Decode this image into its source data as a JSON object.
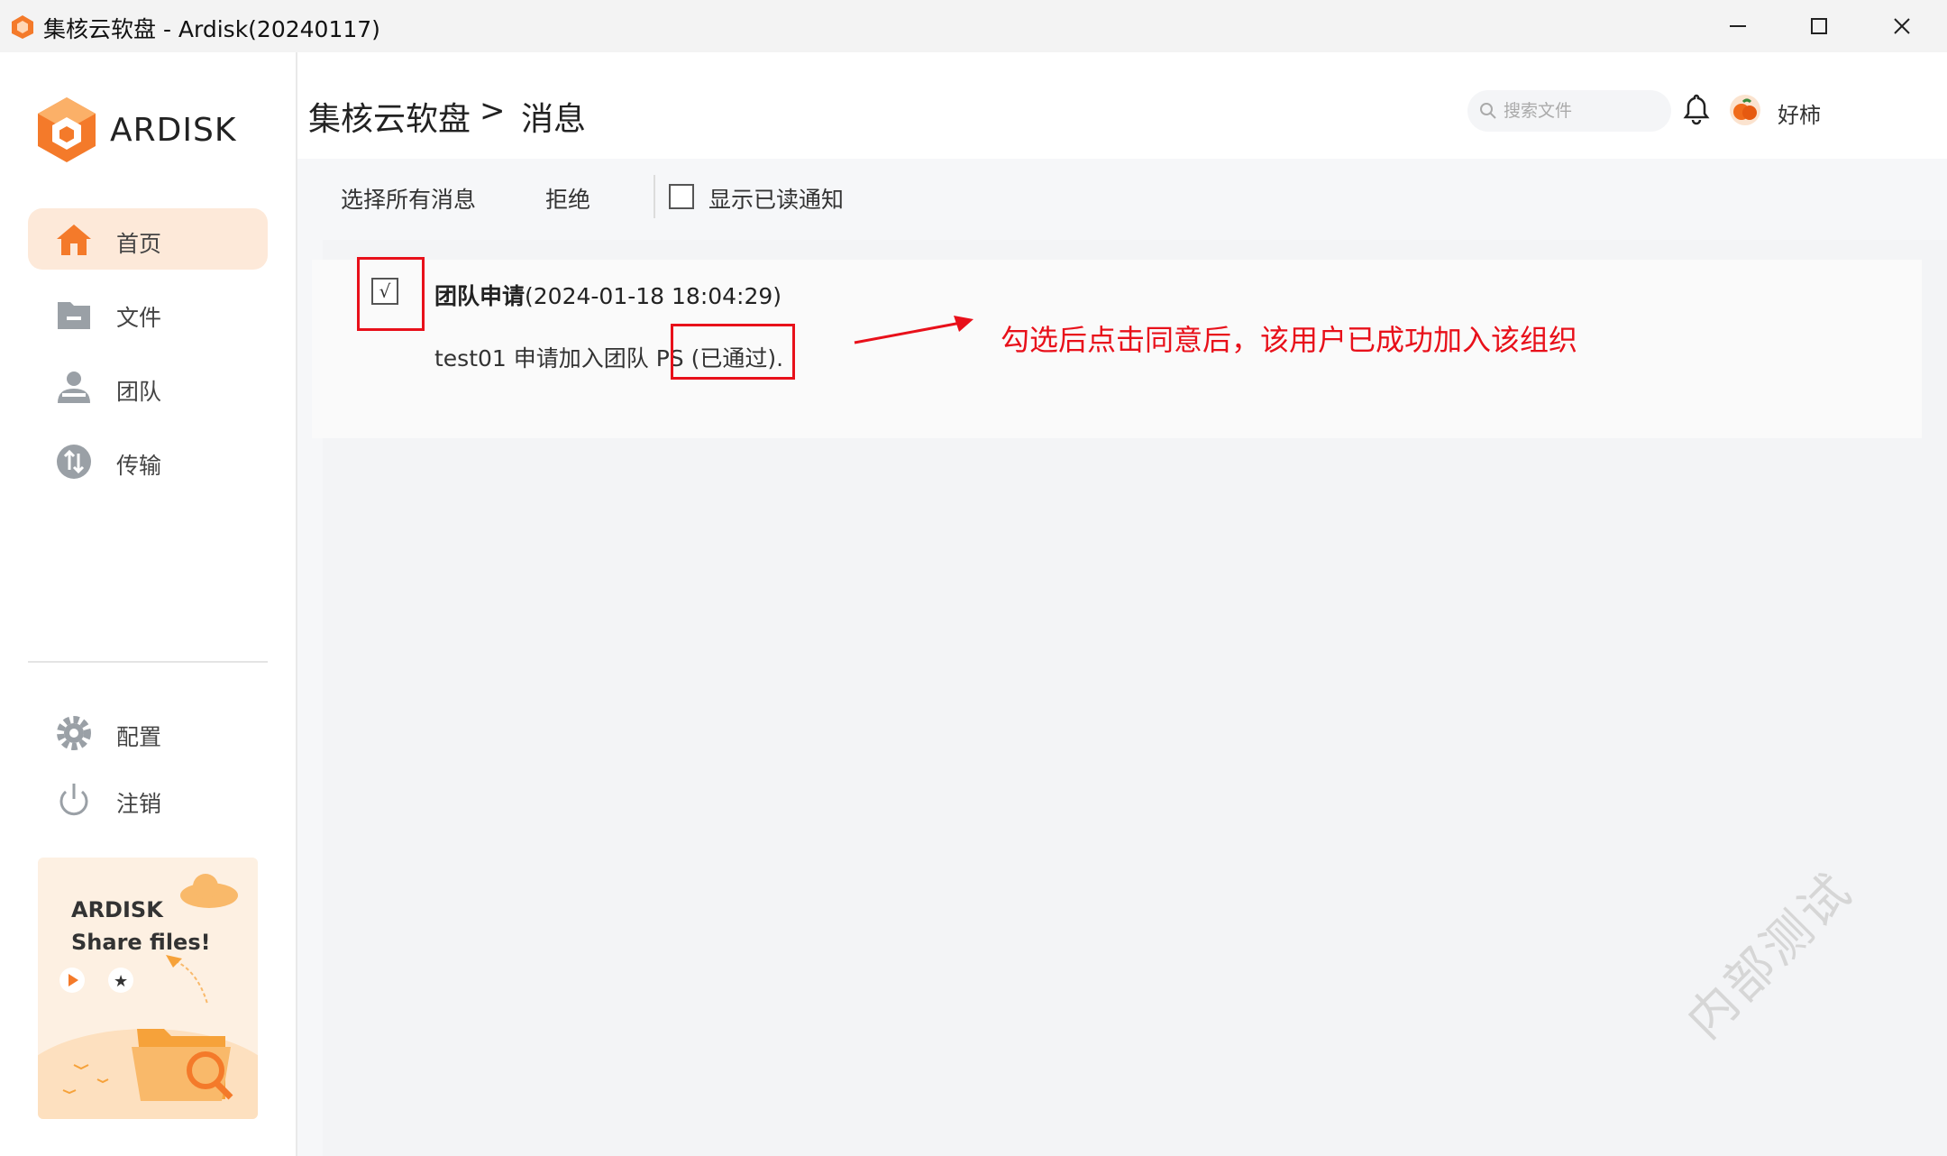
{
  "window": {
    "title": "集核云软盘 - Ardisk(20240117)",
    "controls": {
      "minimize": "minimize-icon",
      "maximize": "maximize-icon",
      "close": "close-icon"
    }
  },
  "sidebar": {
    "brand": "ARDISK",
    "items": [
      {
        "label": "首页",
        "icon": "home-icon",
        "active": true
      },
      {
        "label": "文件",
        "icon": "folder-icon"
      },
      {
        "label": "团队",
        "icon": "team-icon"
      },
      {
        "label": "传输",
        "icon": "transfer-icon"
      }
    ],
    "bottom_items": [
      {
        "label": "配置",
        "icon": "gear-icon"
      },
      {
        "label": "注销",
        "icon": "power-icon"
      }
    ],
    "promo": {
      "line1": "ARDISK",
      "line2": "Share files!"
    }
  },
  "header": {
    "breadcrumb_root": "集核云软盘",
    "breadcrumb_sep": ">",
    "breadcrumb_current": "消息",
    "search_placeholder": "搜索文件",
    "username": "好柿"
  },
  "toolbar": {
    "select_all": "选择所有消息",
    "reject": "拒绝",
    "show_read": "显示已读通知"
  },
  "message": {
    "checked": true,
    "check_mark": "√",
    "title_bold": "团队申请",
    "timestamp": "(2024-01-18 18:04:29)",
    "body": "test01 申请加入团队 PS (已通过)."
  },
  "annotation": {
    "note": "勾选后点击同意后，该用户已成功加入该组织",
    "color": "#e8101a"
  },
  "watermark": "内部测试",
  "colors": {
    "accent": "#f47a2a",
    "active_bg": "#fde9d9",
    "annotation": "#e8101a"
  }
}
